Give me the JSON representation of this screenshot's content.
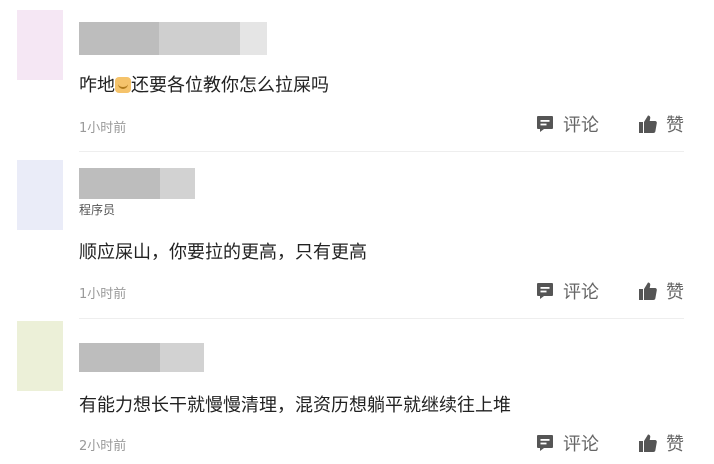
{
  "comments": [
    {
      "user_title": "",
      "content_before": "咋地",
      "content_after": "还要各位教你怎么拉屎吗",
      "time": "1小时前",
      "comment_label": "评论",
      "like_label": "赞",
      "avatar_color": "#f5e7f4"
    },
    {
      "user_title": "程序员",
      "content_before": "顺应屎山，你要拉的更高，只有更高",
      "content_after": "",
      "time": "1小时前",
      "comment_label": "评论",
      "like_label": "赞",
      "avatar_color": "#eaecf8"
    },
    {
      "user_title": "",
      "content_before": "有能力想长干就慢慢清理，混资历想躺平就继续往上堆",
      "content_after": "",
      "time": "2小时前",
      "comment_label": "评论",
      "like_label": "赞",
      "avatar_color": "#ecf0d8"
    }
  ],
  "icons": {
    "comment": "comment-icon",
    "like": "thumbs-up-icon",
    "emoji": "emoji-icon"
  },
  "colors": {
    "action_icon": "#555555",
    "name_blur_dark": "#bdbdbd",
    "name_blur_mid": "#cfcfcf",
    "name_blur_light": "#e5e5e5"
  }
}
